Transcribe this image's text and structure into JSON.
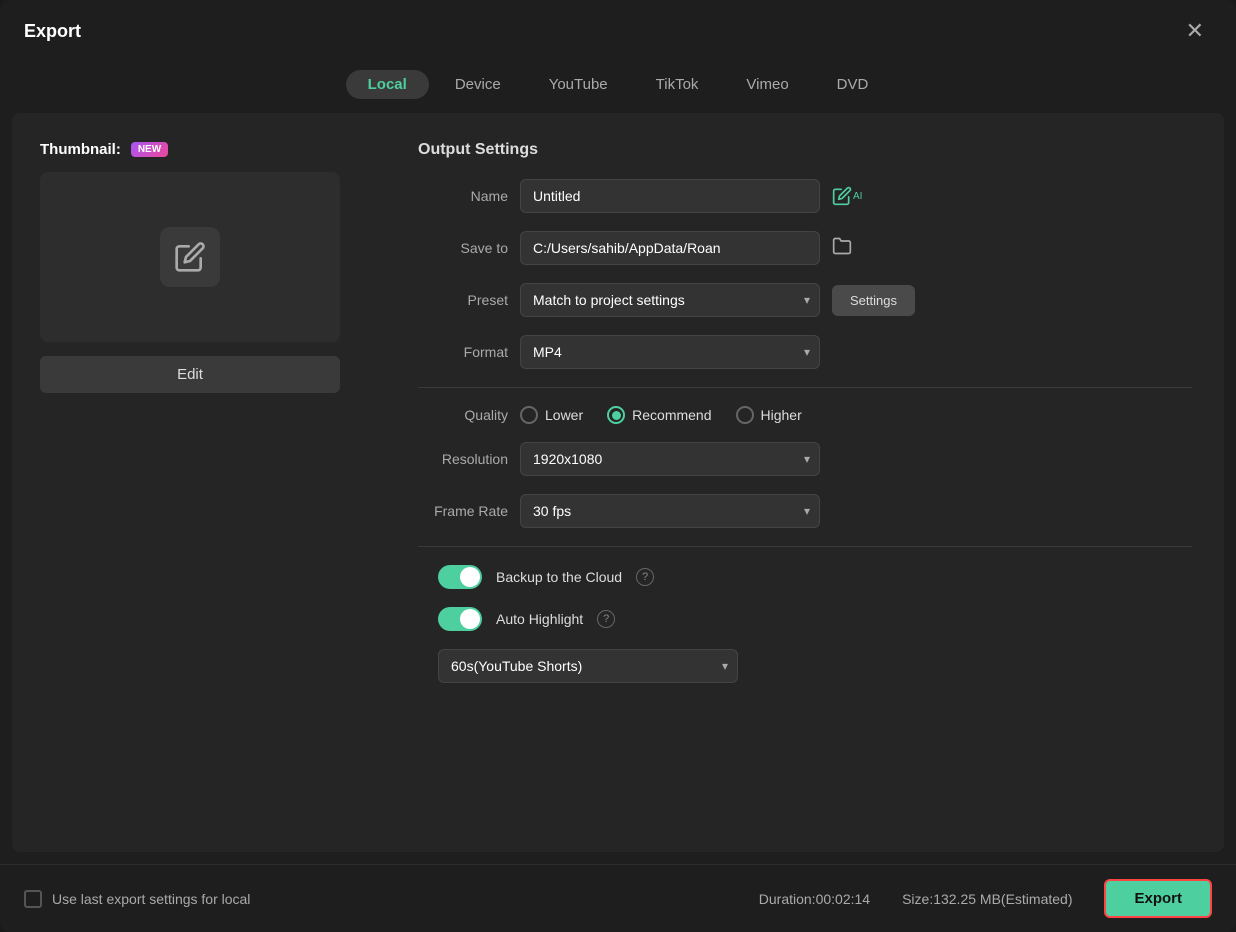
{
  "dialog": {
    "title": "Export",
    "close_label": "✕"
  },
  "tabs": [
    {
      "id": "local",
      "label": "Local",
      "active": true
    },
    {
      "id": "device",
      "label": "Device",
      "active": false
    },
    {
      "id": "youtube",
      "label": "YouTube",
      "active": false
    },
    {
      "id": "tiktok",
      "label": "TikTok",
      "active": false
    },
    {
      "id": "vimeo",
      "label": "Vimeo",
      "active": false
    },
    {
      "id": "dvd",
      "label": "DVD",
      "active": false
    }
  ],
  "left_panel": {
    "thumbnail_label": "Thumbnail:",
    "new_badge": "NEW",
    "edit_button": "Edit"
  },
  "output_settings": {
    "section_title": "Output Settings",
    "name_label": "Name",
    "name_value": "Untitled",
    "save_to_label": "Save to",
    "save_to_value": "C:/Users/sahib/AppData/Roan",
    "preset_label": "Preset",
    "preset_value": "Match to project settings",
    "settings_button": "Settings",
    "format_label": "Format",
    "format_value": "MP4",
    "quality_label": "Quality",
    "quality_options": [
      {
        "label": "Lower",
        "value": "lower",
        "checked": false
      },
      {
        "label": "Recommend",
        "value": "recommend",
        "checked": true
      },
      {
        "label": "Higher",
        "value": "higher",
        "checked": false
      }
    ],
    "resolution_label": "Resolution",
    "resolution_value": "1920x1080",
    "frame_rate_label": "Frame Rate",
    "frame_rate_value": "30 fps",
    "backup_cloud_label": "Backup to the Cloud",
    "backup_cloud_on": true,
    "auto_highlight_label": "Auto Highlight",
    "auto_highlight_on": true,
    "highlight_duration_value": "60s(YouTube Shorts)"
  },
  "footer": {
    "checkbox_label": "Use last export settings for local",
    "duration_label": "Duration:00:02:14",
    "size_label": "Size:132.25 MB(Estimated)",
    "export_button": "Export"
  }
}
